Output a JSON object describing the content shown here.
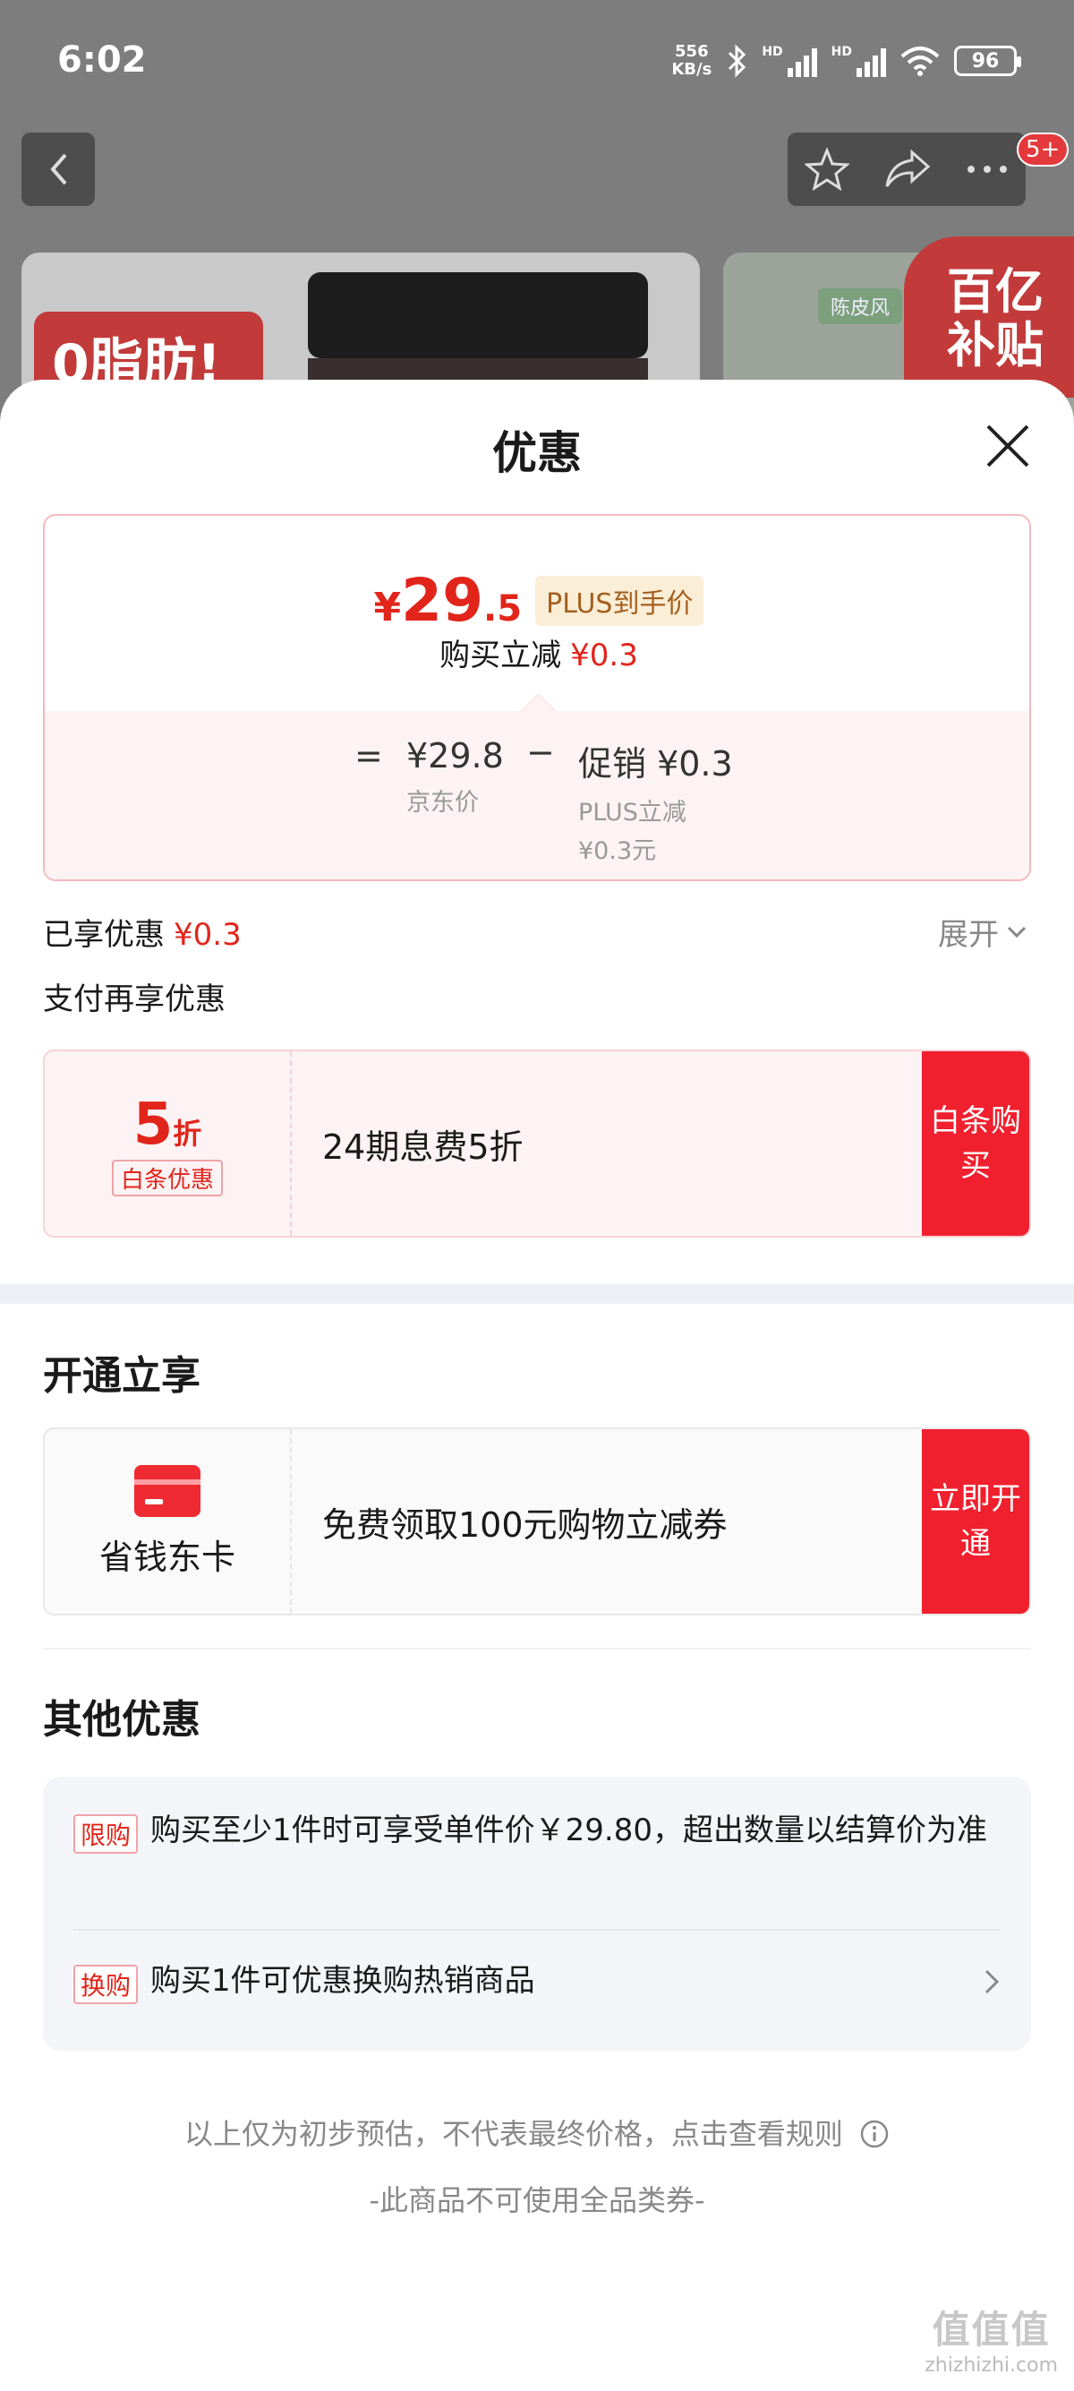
{
  "status_bar": {
    "time": "6:02",
    "net_speed_value": "556",
    "net_speed_unit": "KB/s",
    "signal_label": "HD",
    "battery": "96"
  },
  "nav": {
    "badge": "5+"
  },
  "background": {
    "product_badge": "0脂肪!",
    "side_chip": "陈皮风",
    "subsidy_label": "百亿补贴"
  },
  "sheet": {
    "title": "优惠"
  },
  "price_box": {
    "currency": "¥",
    "price_int": "29",
    "price_dec": ".5",
    "plus_tag": "PLUS到手价",
    "reduce_label": "购买立减",
    "reduce_value": "¥0.3",
    "eq": "=",
    "jd_price": "¥29.8",
    "jd_label": "京东价",
    "minus": "−",
    "promo_line": "促销 ¥0.3",
    "promo_detail_1": "PLUS立减",
    "promo_detail_2": "¥0.3元"
  },
  "enjoyed": {
    "label": "已享优惠",
    "value": "¥0.3",
    "expand_label": "展开"
  },
  "pay_again": "支付再享优惠",
  "baitiao_coupon": {
    "discount_num": "5",
    "discount_unit": "折",
    "tag": "白条优惠",
    "desc": "24期息费5折",
    "button": "白条购买"
  },
  "section_open": {
    "title": "开通立享"
  },
  "card_coupon": {
    "name": "省钱东卡",
    "desc": "免费领取100元购物立减券",
    "button": "立即开通"
  },
  "section_other": {
    "title": "其他优惠",
    "items": [
      {
        "tag": "限购",
        "text": "购买至少1件时可享受单件价￥29.80，超出数量以结算价为准"
      },
      {
        "tag": "换购",
        "text": "购买1件可优惠换购热销商品"
      }
    ]
  },
  "footer": {
    "disclaimer": "以上仅为初步预估，不代表最终价格，点击查看规则",
    "no_coupon": "-此商品不可使用全品类券-",
    "watermark": "zhizhizhi.com"
  },
  "colors": {
    "accent_red": "#e1251b",
    "button_red": "#f0202e",
    "plus_bg": "#fbeed7"
  }
}
